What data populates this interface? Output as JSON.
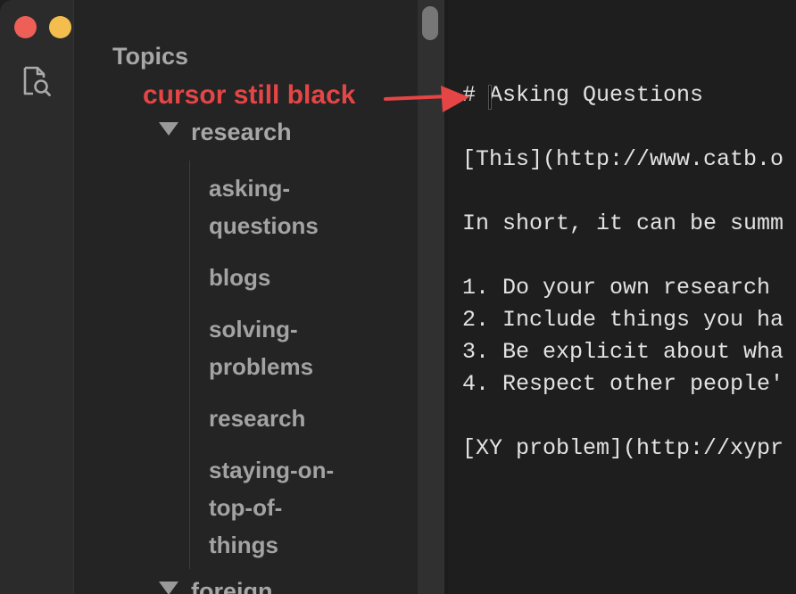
{
  "sidebar": {
    "title": "Topics",
    "folders": [
      {
        "label": "research",
        "expanded": true
      },
      {
        "label": "foreign",
        "expanded": true
      }
    ],
    "files": [
      {
        "lines": [
          "asking-",
          "questions"
        ]
      },
      {
        "lines": [
          "blogs"
        ]
      },
      {
        "lines": [
          "solving-",
          "problems"
        ]
      },
      {
        "lines": [
          "research"
        ]
      },
      {
        "lines": [
          "staying-on-",
          "top-of-",
          "things"
        ]
      }
    ]
  },
  "activity_bar": {
    "icons": [
      "search-files-icon"
    ]
  },
  "editor": {
    "lines": [
      "# Asking Questions",
      "",
      "[This](http://www.catb.o",
      "",
      "In short, it can be summ",
      "",
      "1. Do your own research ",
      "2. Include things you ha",
      "3. Be explicit about wha",
      "4. Respect other people'",
      "",
      "[XY problem](http://xypr"
    ]
  },
  "annotation": {
    "text": "cursor still black",
    "color": "#e64545"
  },
  "colors": {
    "traffic_close": "#ee5f57",
    "traffic_minimize": "#f4be4f",
    "traffic_maximize": "#5cc74f"
  }
}
